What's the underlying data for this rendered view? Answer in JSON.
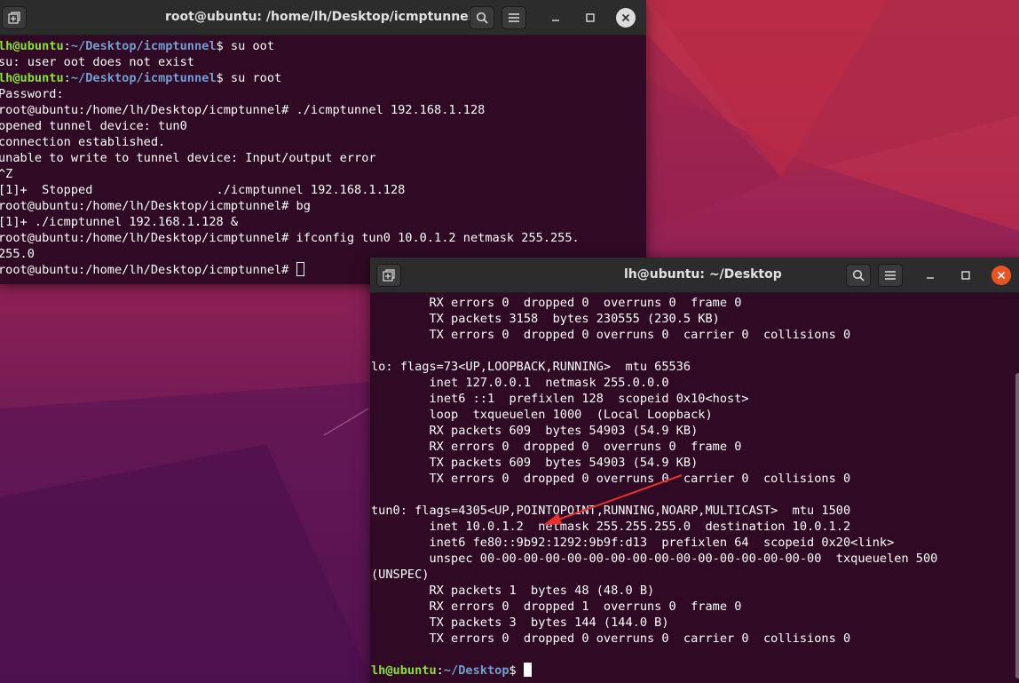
{
  "window1": {
    "title": "root@ubuntu: /home/lh/Desktop/icmptunnel",
    "lines": [
      {
        "user": "lh@ubuntu",
        "sep": ":",
        "path": "~/Desktop/icmptunnel",
        "end": "$ ",
        "cmd": "su oot"
      },
      {
        "text": "su: user oot does not exist"
      },
      {
        "user": "lh@ubuntu",
        "sep": ":",
        "path": "~/Desktop/icmptunnel",
        "end": "$ ",
        "cmd": "su root"
      },
      {
        "text": "Password:"
      },
      {
        "text": "root@ubuntu:/home/lh/Desktop/icmptunnel# ./icmptunnel 192.168.1.128"
      },
      {
        "text": "opened tunnel device: tun0"
      },
      {
        "text": "connection established."
      },
      {
        "text": "unable to write to tunnel device: Input/output error"
      },
      {
        "text": "^Z"
      },
      {
        "text": "[1]+  Stopped                 ./icmptunnel 192.168.1.128"
      },
      {
        "text": "root@ubuntu:/home/lh/Desktop/icmptunnel# bg"
      },
      {
        "text": "[1]+ ./icmptunnel 192.168.1.128 &"
      },
      {
        "text": "root@ubuntu:/home/lh/Desktop/icmptunnel# ifconfig tun0 10.0.1.2 netmask 255.255."
      },
      {
        "text": "255.0"
      },
      {
        "text": "root@ubuntu:/home/lh/Desktop/icmptunnel# ",
        "cursor": "box"
      }
    ]
  },
  "window2": {
    "title": "lh@ubuntu: ~/Desktop",
    "lines": [
      {
        "text": "        RX errors 0  dropped 0  overruns 0  frame 0"
      },
      {
        "text": "        TX packets 3158  bytes 230555 (230.5 KB)"
      },
      {
        "text": "        TX errors 0  dropped 0 overruns 0  carrier 0  collisions 0"
      },
      {
        "text": ""
      },
      {
        "text": "lo: flags=73<UP,LOOPBACK,RUNNING>  mtu 65536"
      },
      {
        "text": "        inet 127.0.0.1  netmask 255.0.0.0"
      },
      {
        "text": "        inet6 ::1  prefixlen 128  scopeid 0x10<host>"
      },
      {
        "text": "        loop  txqueuelen 1000  (Local Loopback)"
      },
      {
        "text": "        RX packets 609  bytes 54903 (54.9 KB)"
      },
      {
        "text": "        RX errors 0  dropped 0  overruns 0  frame 0"
      },
      {
        "text": "        TX packets 609  bytes 54903 (54.9 KB)"
      },
      {
        "text": "        TX errors 0  dropped 0 overruns 0  carrier 0  collisions 0"
      },
      {
        "text": ""
      },
      {
        "text": "tun0: flags=4305<UP,POINTOPOINT,RUNNING,NOARP,MULTICAST>  mtu 1500"
      },
      {
        "text": "        inet 10.0.1.2  netmask 255.255.255.0  destination 10.0.1.2"
      },
      {
        "text": "        inet6 fe80::9b92:1292:9b9f:d13  prefixlen 64  scopeid 0x20<link>"
      },
      {
        "text": "        unspec 00-00-00-00-00-00-00-00-00-00-00-00-00-00-00-00  txqueuelen 500"
      },
      {
        "text": "(UNSPEC)"
      },
      {
        "text": "        RX packets 1  bytes 48 (48.0 B)"
      },
      {
        "text": "        RX errors 0  dropped 1  overruns 0  frame 0"
      },
      {
        "text": "        TX packets 3  bytes 144 (144.0 B)"
      },
      {
        "text": "        TX errors 0  dropped 0 overruns 0  carrier 0  collisions 0"
      },
      {
        "text": ""
      },
      {
        "user": "lh@ubuntu",
        "sep": ":",
        "path": "~/Desktop",
        "end": "$ ",
        "cmd": "",
        "cursor": "solid"
      }
    ]
  },
  "icons": [
    "new-tab-icon",
    "search-icon",
    "hamburger-menu-icon",
    "minimize-icon",
    "maximize-icon",
    "close-icon"
  ],
  "colors": {
    "terminal_bg": "#300a24",
    "prompt_user": "#8ae234",
    "prompt_path": "#729fcf",
    "annotation_arrow": "#e8302e",
    "close_active": "#e95420"
  }
}
